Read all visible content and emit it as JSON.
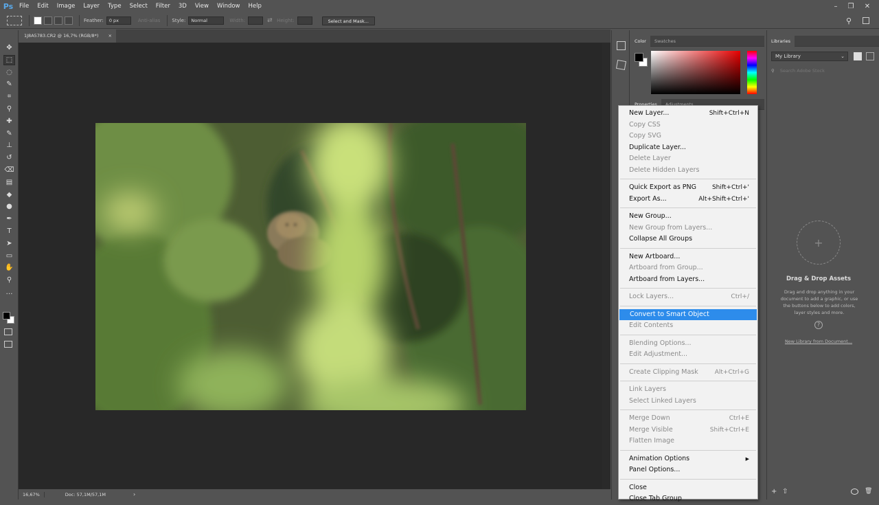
{
  "app": {
    "logo": "Ps"
  },
  "menubar": {
    "items": [
      "File",
      "Edit",
      "Image",
      "Layer",
      "Type",
      "Select",
      "Filter",
      "3D",
      "View",
      "Window",
      "Help"
    ]
  },
  "window_controls": {
    "minimize": "–",
    "restore": "❐",
    "close": "✕"
  },
  "options": {
    "feather_label": "Feather:",
    "feather_value": "0 px",
    "antialias_label": "Anti-alias",
    "style_label": "Style:",
    "style_value": "Normal",
    "width_label": "Width:",
    "height_label": "Height:",
    "select_mask_label": "Select and Mask..."
  },
  "document": {
    "tab_title": "1J8A5783.CR2 @ 16,7% (RGB/8*)"
  },
  "status": {
    "zoom": "16,67%",
    "doc": "Doc: 57,1M/57,1M"
  },
  "color_panel": {
    "tabs": [
      "Color",
      "Swatches"
    ],
    "fg": "#000000",
    "bg": "#ffffff"
  },
  "properties_panel": {
    "tabs": [
      "Properties",
      "Adjustments"
    ]
  },
  "libraries": {
    "tab": "Libraries",
    "library_name": "My Library",
    "search_placeholder": "Search Adobe Stock",
    "dropzone_title": "Drag & Drop Assets",
    "dropzone_text": "Drag and drop anything in your document to add a graphic, or use the buttons below to add colors, layer styles and more.",
    "new_library_link": "New Library from Document..."
  },
  "context_menu": {
    "groups": [
      [
        {
          "label": "New Layer...",
          "shortcut": "Shift+Ctrl+N",
          "enabled": true
        },
        {
          "label": "Copy CSS",
          "shortcut": "",
          "enabled": false
        },
        {
          "label": "Copy SVG",
          "shortcut": "",
          "enabled": false
        },
        {
          "label": "Duplicate Layer...",
          "shortcut": "",
          "enabled": true
        },
        {
          "label": "Delete Layer",
          "shortcut": "",
          "enabled": false
        },
        {
          "label": "Delete Hidden Layers",
          "shortcut": "",
          "enabled": false
        }
      ],
      [
        {
          "label": "Quick Export as PNG",
          "shortcut": "Shift+Ctrl+'",
          "enabled": true
        },
        {
          "label": "Export As...",
          "shortcut": "Alt+Shift+Ctrl+'",
          "enabled": true
        }
      ],
      [
        {
          "label": "New Group...",
          "shortcut": "",
          "enabled": true
        },
        {
          "label": "New Group from Layers...",
          "shortcut": "",
          "enabled": false
        },
        {
          "label": "Collapse All Groups",
          "shortcut": "",
          "enabled": true
        }
      ],
      [
        {
          "label": "New Artboard...",
          "shortcut": "",
          "enabled": true
        },
        {
          "label": "Artboard from Group...",
          "shortcut": "",
          "enabled": false
        },
        {
          "label": "Artboard from Layers...",
          "shortcut": "",
          "enabled": true
        }
      ],
      [
        {
          "label": "Lock Layers...",
          "shortcut": "Ctrl+/",
          "enabled": false
        }
      ],
      [
        {
          "label": "Convert to Smart Object",
          "shortcut": "",
          "enabled": true,
          "highlighted": true
        },
        {
          "label": "Edit Contents",
          "shortcut": "",
          "enabled": false
        }
      ],
      [
        {
          "label": "Blending Options...",
          "shortcut": "",
          "enabled": false
        },
        {
          "label": "Edit Adjustment...",
          "shortcut": "",
          "enabled": false
        }
      ],
      [
        {
          "label": "Create Clipping Mask",
          "shortcut": "Alt+Ctrl+G",
          "enabled": false
        }
      ],
      [
        {
          "label": "Link Layers",
          "shortcut": "",
          "enabled": false
        },
        {
          "label": "Select Linked Layers",
          "shortcut": "",
          "enabled": false
        }
      ],
      [
        {
          "label": "Merge Down",
          "shortcut": "Ctrl+E",
          "enabled": false
        },
        {
          "label": "Merge Visible",
          "shortcut": "Shift+Ctrl+E",
          "enabled": false
        },
        {
          "label": "Flatten Image",
          "shortcut": "",
          "enabled": false
        }
      ],
      [
        {
          "label": "Animation Options",
          "shortcut": "",
          "enabled": true,
          "submenu": true
        },
        {
          "label": "Panel Options...",
          "shortcut": "",
          "enabled": true
        }
      ],
      [
        {
          "label": "Close",
          "shortcut": "",
          "enabled": true
        },
        {
          "label": "Close Tab Group",
          "shortcut": "",
          "enabled": true
        }
      ]
    ]
  }
}
